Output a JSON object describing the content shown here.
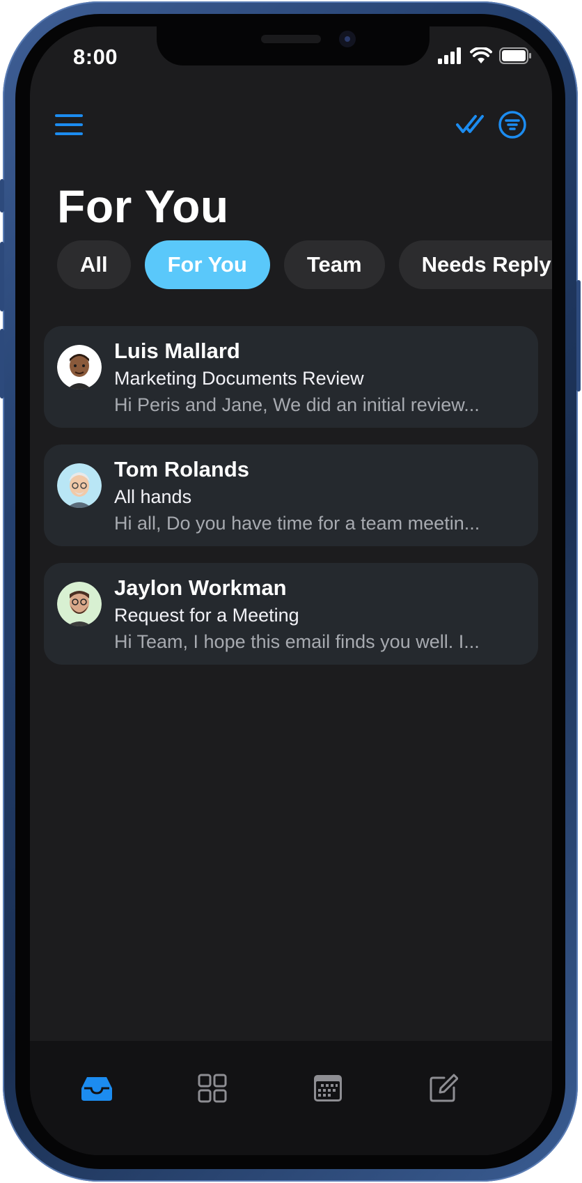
{
  "status_bar": {
    "time": "8:00",
    "icons": [
      "cellular-signal-icon",
      "wifi-icon",
      "battery-icon"
    ]
  },
  "header": {
    "menu_icon": "hamburger-menu-icon",
    "actions": [
      "mark-all-read-icon",
      "filter-icon"
    ],
    "title": "For You"
  },
  "filters": {
    "chips": [
      {
        "label": "All",
        "active": false
      },
      {
        "label": "For You",
        "active": true
      },
      {
        "label": "Team",
        "active": false
      },
      {
        "label": "Needs Reply",
        "active": false
      }
    ]
  },
  "mails": [
    {
      "sender": "Luis Mallard",
      "subject": "Marketing Documents Review",
      "preview": "Hi Peris and Jane, We did an initial review...",
      "avatar_icon": "memoji-avatar-icon"
    },
    {
      "sender": "Tom Rolands",
      "subject": "All hands",
      "preview": "Hi all, Do you have time for a team meetin...",
      "avatar_icon": "memoji-avatar-icon"
    },
    {
      "sender": "Jaylon Workman",
      "subject": "Request for a Meeting",
      "preview": "Hi Team, I hope this email finds you well. I...",
      "avatar_icon": "memoji-avatar-icon"
    }
  ],
  "tabbar": {
    "tabs": [
      {
        "icon": "inbox-tray-icon",
        "active": true
      },
      {
        "icon": "grid-apps-icon",
        "active": false
      },
      {
        "icon": "calendar-icon",
        "active": false
      },
      {
        "icon": "compose-icon",
        "active": false
      }
    ]
  },
  "colors": {
    "accent": "#1c8cf0",
    "chip_active": "#5ac8fa",
    "chip_bg": "#2c2c2e",
    "card_bg": "#25292e",
    "screen_bg": "#1c1c1e",
    "tabbar_bg": "#121214",
    "preview_text": "#a7aab0",
    "inactive_icon": "#8e8e93"
  }
}
